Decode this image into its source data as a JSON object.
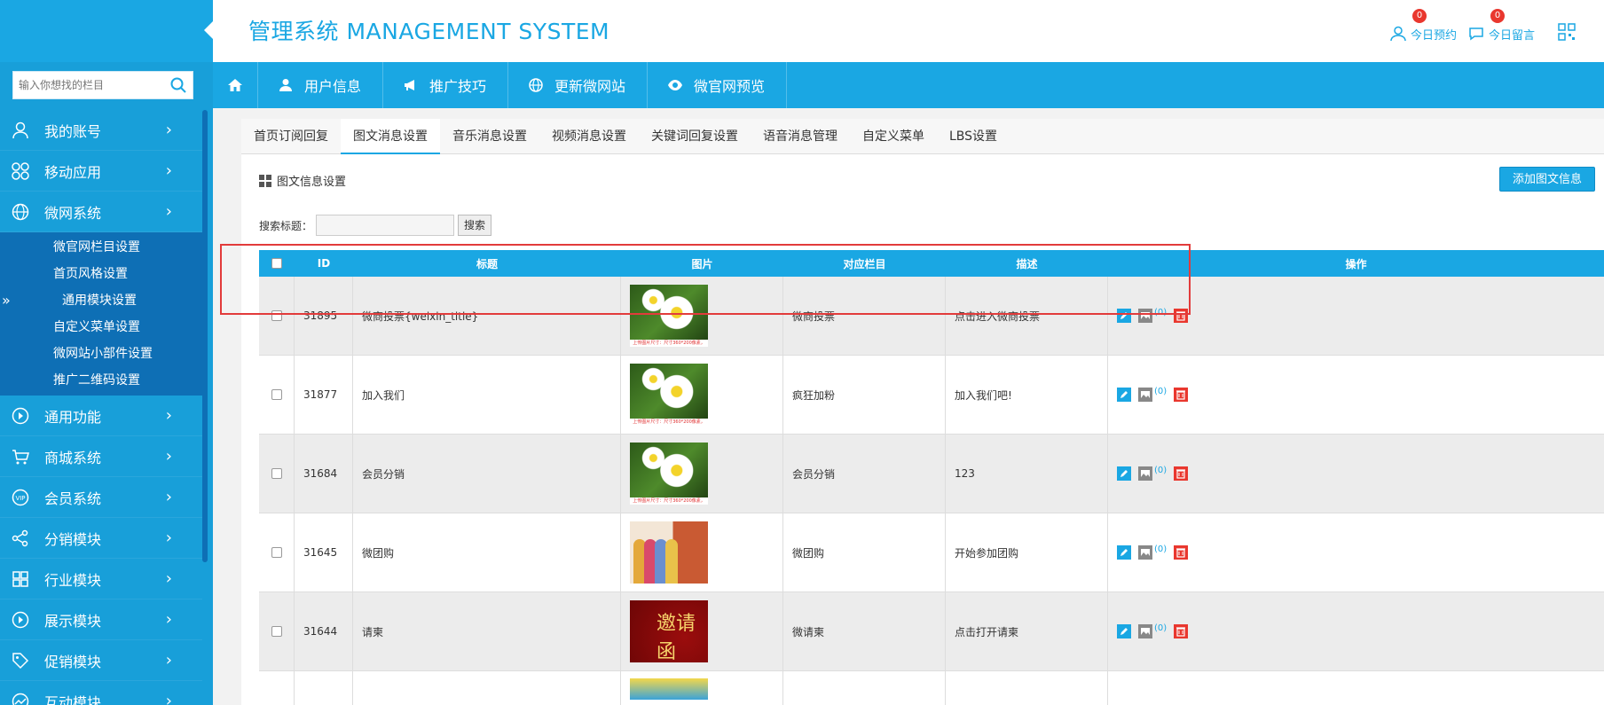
{
  "header": {
    "title": "管理系统 MANAGEMENT SYSTEM",
    "reservation": {
      "label": "今日预约",
      "count": "0"
    },
    "messages": {
      "label": "今日留言",
      "count": "0"
    }
  },
  "sidebar": {
    "search_placeholder": "输入你想找的栏目",
    "items": [
      {
        "label": "我的账号",
        "icon": "user-icon"
      },
      {
        "label": "移动应用",
        "icon": "app-icon"
      },
      {
        "label": "微网系统",
        "icon": "globe-icon"
      },
      {
        "label": "通用功能",
        "icon": "play-icon"
      },
      {
        "label": "商城系统",
        "icon": "cart-icon"
      },
      {
        "label": "会员系统",
        "icon": "vip-icon"
      },
      {
        "label": "分销模块",
        "icon": "share-icon"
      },
      {
        "label": "行业模块",
        "icon": "grid-icon"
      },
      {
        "label": "展示模块",
        "icon": "play-icon"
      },
      {
        "label": "促销模块",
        "icon": "tag-icon"
      },
      {
        "label": "互动模块",
        "icon": "chart-icon"
      }
    ],
    "submenu": [
      "微官网栏目设置",
      "首页风格设置",
      "通用模块设置",
      "自定义菜单设置",
      "微网站小部件设置",
      "推广二维码设置"
    ],
    "active_arrows": "»"
  },
  "topnav": [
    "用户信息",
    "推广技巧",
    "更新微网站",
    "微官网预览"
  ],
  "tabs": [
    "首页订阅回复",
    "图文消息设置",
    "音乐消息设置",
    "视频消息设置",
    "关键词回复设置",
    "语音消息管理",
    "自定义菜单",
    "LBS设置"
  ],
  "content": {
    "section_title": "图文信息设置",
    "add_button": "添加图文信息",
    "search_label": "搜索标题：",
    "search_button": "搜索"
  },
  "table": {
    "headers": [
      "ID",
      "标题",
      "图片",
      "对应栏目",
      "描述",
      "操作"
    ],
    "rows": [
      {
        "id": "31895",
        "title": "微商投票{weixin_title}",
        "column": "微商投票",
        "desc": "点击进入微商投票",
        "count": "(0)",
        "pic": "flower"
      },
      {
        "id": "31877",
        "title": "加入我们",
        "column": "疯狂加粉",
        "desc": "加入我们吧!",
        "count": "(0)",
        "pic": "flower"
      },
      {
        "id": "31684",
        "title": "会员分销",
        "column": "会员分销",
        "desc": "123",
        "count": "(0)",
        "pic": "flower"
      },
      {
        "id": "31645",
        "title": "微团购",
        "column": "微团购",
        "desc": "开始参加团购",
        "count": "(0)",
        "pic": "shop"
      },
      {
        "id": "31644",
        "title": "请柬",
        "column": "微请柬",
        "desc": "点击打开请柬",
        "count": "(0)",
        "pic": "invite"
      }
    ],
    "pic_strip_text": "上传图片尺寸：尺寸360*200像素，JPG或GIF",
    "invite_text": "邀请函"
  },
  "colors": {
    "primary": "#1aa7e3",
    "sidebar": "#189fd9",
    "submenu": "#0e6fb5",
    "danger": "#e9372e"
  }
}
